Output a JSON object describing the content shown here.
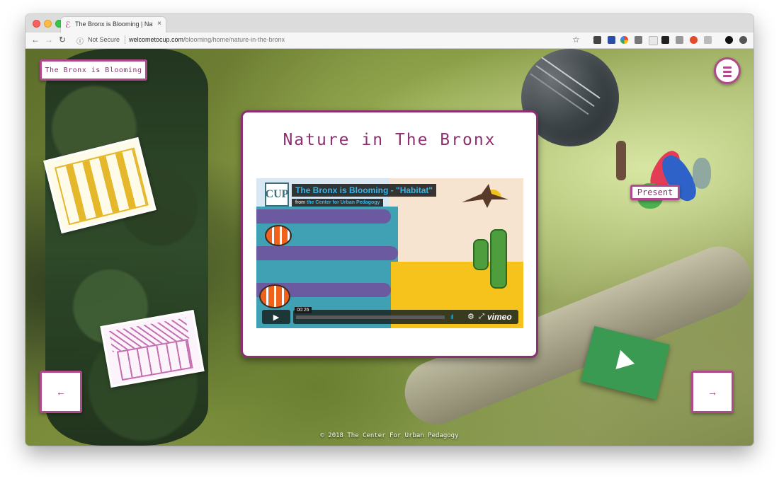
{
  "browser": {
    "tab_title": "The Bronx is Blooming | Nature",
    "tab_close": "×",
    "favicon": "cup-logo-icon",
    "security_label": "Not Secure",
    "url_domain": "welcometocup.com",
    "url_path": "/blooming/home/nature-in-the-bronx",
    "nav_back": "←",
    "nav_forward": "→",
    "nav_reload": "↻",
    "bookmark": "☆",
    "info": "ⓘ"
  },
  "site": {
    "home_label": "The Bronx is Blooming",
    "page_title": "Nature in The Bronx",
    "present_label": "Present",
    "prev_label": "←",
    "next_label": "→",
    "footer": "© 2018 The Center For Urban Pedagogy"
  },
  "video": {
    "logo_text": "CUP",
    "title": "The Bronx is Blooming - \"Habitat\"",
    "from_prefix": "from",
    "from_link": "the Center for Urban Pedagogy",
    "time": "00:26",
    "brand": "vimeo",
    "play": "▶",
    "volume": "ıll",
    "settings": "⚙",
    "fullscreen": "⤢"
  },
  "colors": {
    "accent": "#8d2f71",
    "border": "#b04a8c",
    "vimeo_blue": "#39b4e5",
    "play_card": "#3a9a52"
  }
}
